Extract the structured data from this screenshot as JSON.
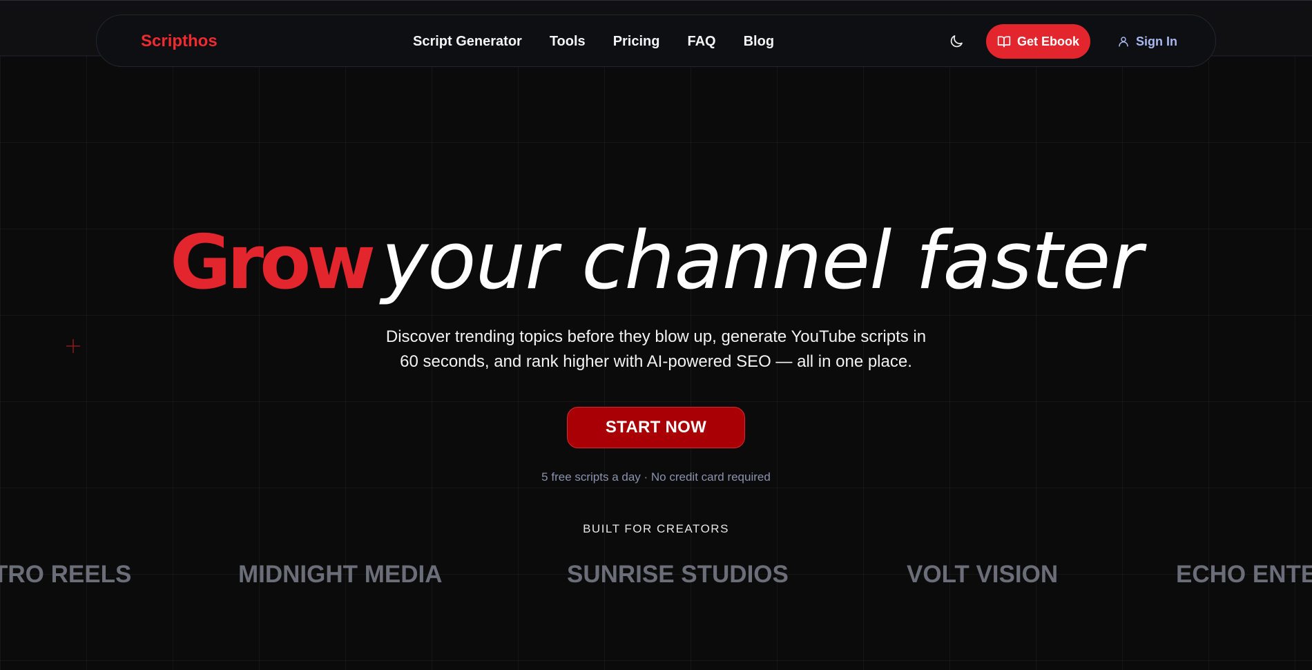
{
  "colors": {
    "accent": "#e3262d",
    "cta": "#a80004",
    "link_blue": "#a9b8f0",
    "muted": "#8b93ad",
    "brand_gray": "#6b6e78"
  },
  "navbar": {
    "logo": "Scripthos",
    "links": [
      "Script Generator",
      "Tools",
      "Pricing",
      "FAQ",
      "Blog"
    ],
    "theme_icon": "moon-icon",
    "ebook_button": {
      "icon": "book-open-icon",
      "label": "Get Ebook"
    },
    "signin": {
      "icon": "user-icon",
      "label": "Sign In"
    }
  },
  "hero": {
    "headline_strong": "Grow",
    "headline_rest": "your channel faster",
    "subtitle_line1": "Discover trending topics before they blow up, generate YouTube scripts in",
    "subtitle_line2": "60 seconds, and rank higher with AI-powered SEO — all in one place.",
    "cta": "START NOW",
    "note": "5 free scripts a day · No credit card required",
    "decor_icon": "plus-icon"
  },
  "brands": {
    "heading": "BUILT FOR CREATORS",
    "items": [
      "TRO REELS",
      "MIDNIGHT MEDIA",
      "SUNRISE STUDIOS",
      "VOLT VISION",
      "ECHO ENTE"
    ]
  }
}
